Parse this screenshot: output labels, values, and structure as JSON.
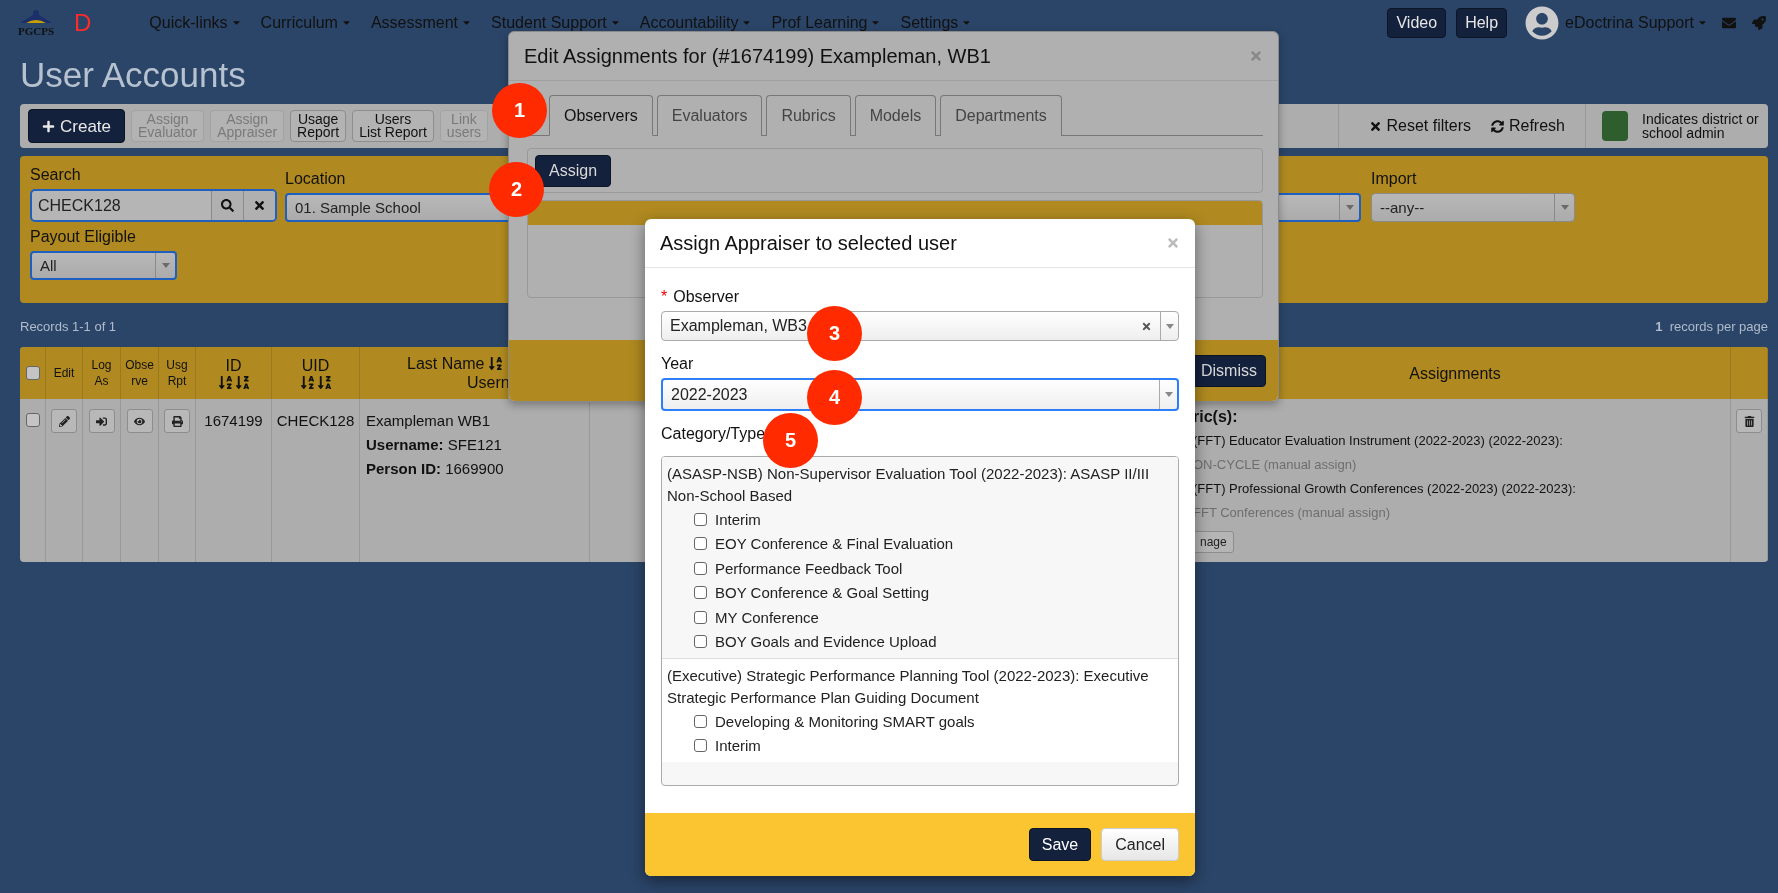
{
  "navbar": {
    "logo_text": "PGCPS",
    "brand_letter": "D",
    "menu": [
      "Quick-links",
      "Curriculum",
      "Assessment",
      "Student Support",
      "Accountability",
      "Prof Learning",
      "Settings"
    ],
    "buttons": [
      "Video",
      "Help"
    ],
    "user": "eDoctrina Support"
  },
  "page_title": "User Accounts",
  "toolbar": {
    "buttons": [
      {
        "lines": [
          "Create"
        ],
        "kind": "primary",
        "disabled": false
      },
      {
        "lines": [
          "Assign",
          "Evaluator"
        ],
        "kind": "default",
        "disabled": true
      },
      {
        "lines": [
          "Assign",
          "Appraiser"
        ],
        "kind": "default",
        "disabled": true
      },
      {
        "lines": [
          "Usage",
          "Report"
        ],
        "kind": "default",
        "disabled": false
      },
      {
        "lines": [
          "Users",
          "List Report"
        ],
        "kind": "default",
        "disabled": false
      },
      {
        "lines": [
          "Link",
          "users"
        ],
        "kind": "default",
        "disabled": true
      }
    ],
    "reset": "Reset filters",
    "refresh": "Refresh",
    "legend": "Indicates district or school admin"
  },
  "filters": {
    "search": {
      "label": "Search",
      "value": "CHECK128",
      "focused": true
    },
    "location": {
      "label": "Location",
      "value": "01. Sample School",
      "focused": true
    },
    "import": {
      "label": "Import",
      "value": "--any--",
      "focused": false
    },
    "payout": {
      "label": "Payout Eligible",
      "value": "All",
      "focused": true
    }
  },
  "records": "Records 1-1 of 1",
  "per_page": {
    "count": "1",
    "label": "records per page"
  },
  "table": {
    "header_checked": false,
    "columns": [
      {
        "lines": [
          "Edit"
        ],
        "sort": false
      },
      {
        "lines": [
          "Log",
          "As"
        ],
        "sort": false
      },
      {
        "lines": [
          "Obse",
          "rve"
        ],
        "sort": false
      },
      {
        "lines": [
          "Usg",
          "Rpt"
        ],
        "sort": false
      },
      {
        "lines": [
          "ID"
        ],
        "sort": true
      },
      {
        "lines": [
          "UID"
        ],
        "sort": true
      },
      {
        "lines": [
          "Last Name",
          "Usern"
        ],
        "sort": true
      },
      {
        "lines": [
          "Assignments"
        ],
        "sort": false
      }
    ],
    "rows": [
      {
        "checked": false,
        "id": "1674199",
        "uid": "CHECK128",
        "name": "Exampleman WB1",
        "details": [
          {
            "label": "Username:",
            "value": "SFE121"
          },
          {
            "label": "Person ID:",
            "value": "1669900"
          }
        ],
        "assignments": [
          {
            "kind": "heading",
            "text": "ric(s):"
          },
          {
            "kind": "item",
            "text": "(FFT) Educator Evaluation Instrument (2022-2023) (2022-2023):"
          },
          {
            "kind": "note",
            "text": "ON-CYCLE (manual assign)"
          },
          {
            "kind": "item",
            "text": "(FFT) Professional Growth Conferences (2022-2023) (2022-2023):"
          },
          {
            "kind": "note",
            "text": "FFT Conferences (manual assign)"
          }
        ],
        "manage": "nage"
      }
    ]
  },
  "edit_dialog": {
    "title": "Edit Assignments for (#1674199) Exampleman, WB1",
    "tabs": [
      {
        "label": "Observers",
        "selected": true
      },
      {
        "label": "Evaluators",
        "selected": false
      },
      {
        "label": "Rubrics",
        "selected": false
      },
      {
        "label": "Models",
        "selected": false
      },
      {
        "label": "Departments",
        "selected": false
      }
    ],
    "assign": "Assign",
    "dismiss": "Dismiss"
  },
  "assign_dialog": {
    "title": "Assign Appraiser to selected user",
    "observer": {
      "required_mark": "*",
      "label": "Observer",
      "value": "Exampleman, WB3",
      "focused": false
    },
    "year": {
      "label": "Year",
      "value": "2022-2023",
      "focused": true
    },
    "category_label": "Category/Type",
    "groups": [
      {
        "title": "(ASASP-NSB) Non-Supervisor Evaluation Tool (2022-2023): ASASP II/III Non-School Based",
        "options": [
          {
            "label": "Interim",
            "checked": false
          },
          {
            "label": "EOY Conference & Final Evaluation",
            "checked": false
          },
          {
            "label": "Performance Feedback Tool",
            "checked": false
          },
          {
            "label": "BOY Conference & Goal Setting",
            "checked": false
          },
          {
            "label": "MY Conference",
            "checked": false
          },
          {
            "label": "BOY Goals and Evidence Upload",
            "checked": false
          }
        ]
      },
      {
        "title": "(Executive) Strategic Performance Planning Tool (2022-2023): Executive Strategic Performance Plan Guiding Document",
        "options": [
          {
            "label": "Developing & Monitoring SMART goals",
            "checked": false
          },
          {
            "label": "Interim",
            "checked": false
          }
        ]
      }
    ],
    "save": "Save",
    "cancel": "Cancel"
  },
  "callouts": [
    "1",
    "2",
    "3",
    "4",
    "5"
  ]
}
